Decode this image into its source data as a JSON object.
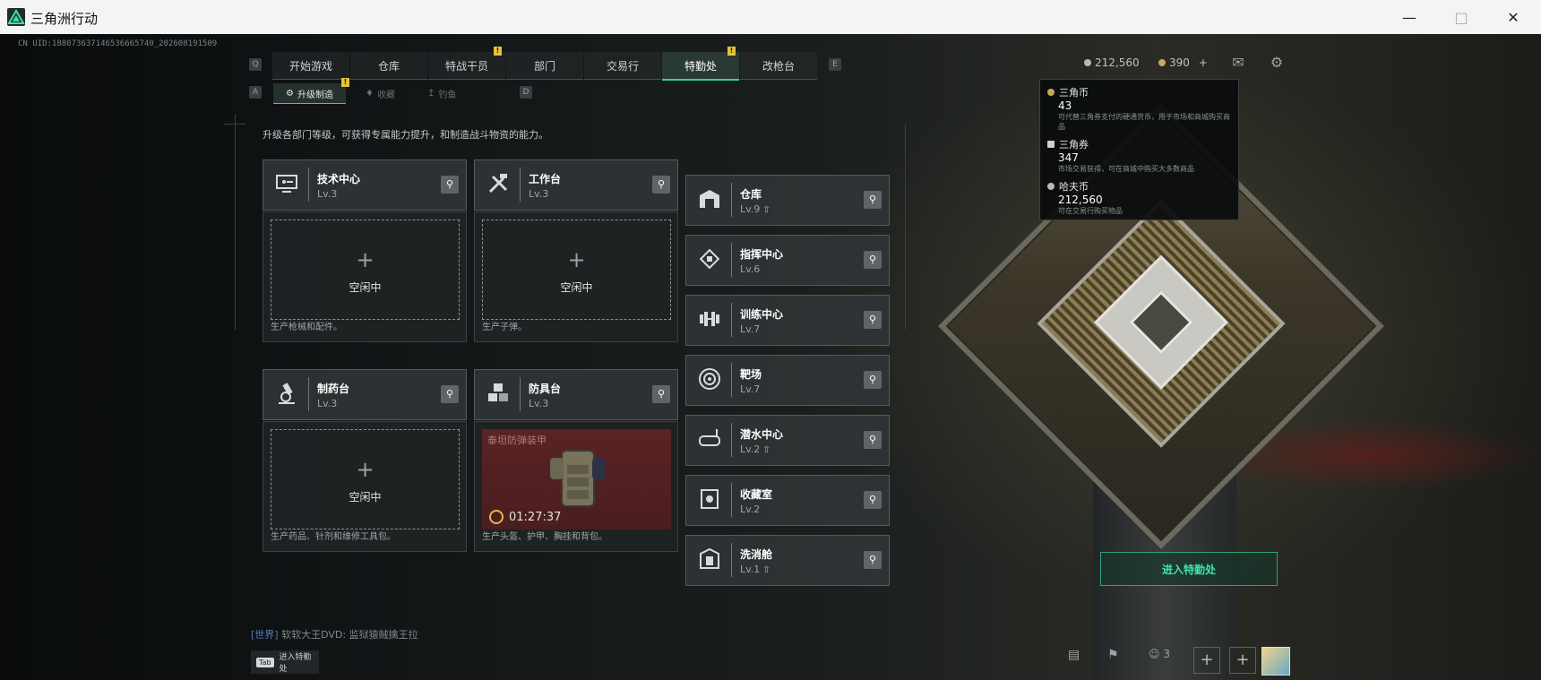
{
  "window": {
    "title": "三角洲行动",
    "minimize_icon": "minimize-icon",
    "maximize_icon": "maximize-icon",
    "close_icon": "close-icon"
  },
  "uid_text": "CN UID:18807363714653666574​0_20260819​1509",
  "nav": {
    "key_left": "Q",
    "key_right": "E",
    "tabs": [
      {
        "label": "开始游戏",
        "badge": ""
      },
      {
        "label": "仓库",
        "badge": ""
      },
      {
        "label": "特战干员",
        "badge": "!"
      },
      {
        "label": "部门",
        "badge": ""
      },
      {
        "label": "交易行",
        "badge": ""
      },
      {
        "label": "特勤处",
        "badge": "!"
      },
      {
        "label": "改枪台",
        "badge": ""
      }
    ],
    "active_tab": "特勤处"
  },
  "subnav": {
    "key_left": "A",
    "key_right": "D",
    "tabs": [
      {
        "label": "升级制造",
        "badge": "!"
      },
      {
        "label": "收藏",
        "badge": ""
      },
      {
        "label": "钓鱼",
        "badge": ""
      }
    ]
  },
  "header": {
    "havoc_coin": "212,560",
    "triangle_coin": "390",
    "add_label": "+",
    "mail_icon": "mail-icon",
    "settings_icon": "gear-icon"
  },
  "tooltip": {
    "items": [
      {
        "name": "三角币",
        "amount": "43",
        "desc": "可代替三角券支付的硬通货币，用于市场和商城购买商品",
        "color": "#c7a75a"
      },
      {
        "name": "三角券",
        "amount": "347",
        "desc": "市场交易获得，可在商城中购买大多数商品",
        "color": "#d0d0d0"
      },
      {
        "name": "哈夫币",
        "amount": "212,560",
        "desc": "可在交易行购买物品",
        "color": "#b8b8b8"
      }
    ]
  },
  "intro": "升级各部门等级，可获得专属能力提升，和制造战斗物资的能力。",
  "workstations": [
    {
      "name": "技术中心",
      "level": "Lv.3",
      "icon": "computer-icon",
      "state": "空闲中",
      "desc": "生产枪械和配件。"
    },
    {
      "name": "工作台",
      "level": "Lv.3",
      "icon": "tools-icon",
      "state": "空闲中",
      "desc": "生产子弹。"
    },
    {
      "name": "制药台",
      "level": "Lv.3",
      "icon": "microscope-icon",
      "state": "空闲中",
      "desc": "生产药品、针剂和维修工具包。"
    },
    {
      "name": "防具台",
      "level": "Lv.3",
      "icon": "boxes-icon",
      "state": "",
      "desc": "生产头盔、护甲、胸挂和背包。",
      "item_name": "泰坦防弹装甲",
      "timer": "01:27:37"
    }
  ],
  "facilities": [
    {
      "name": "仓库",
      "level": "Lv.9",
      "upgrade": true,
      "icon": "warehouse-icon"
    },
    {
      "name": "指挥中心",
      "level": "Lv.6",
      "upgrade": false,
      "icon": "command-icon"
    },
    {
      "name": "训练中心",
      "level": "Lv.7",
      "upgrade": false,
      "icon": "dumbbell-icon"
    },
    {
      "name": "靶场",
      "level": "Lv.7",
      "upgrade": false,
      "icon": "target-icon"
    },
    {
      "name": "潜水中心",
      "level": "Lv.2",
      "upgrade": true,
      "icon": "diving-mask-icon"
    },
    {
      "name": "收藏室",
      "level": "Lv.2",
      "upgrade": false,
      "icon": "collection-icon"
    },
    {
      "name": "洗消舱",
      "level": "Lv.1",
      "upgrade": true,
      "icon": "decon-icon"
    }
  ],
  "enter_button": "进入特勤处",
  "chat": {
    "channel": "[世界]",
    "text": "软软大王DVD: 监狱猿贼擒王拉"
  },
  "tab_hint": {
    "key": "Tab",
    "label": "进入特勤处"
  },
  "bottom_bar": {
    "friends_count": "3",
    "plus": "+"
  }
}
